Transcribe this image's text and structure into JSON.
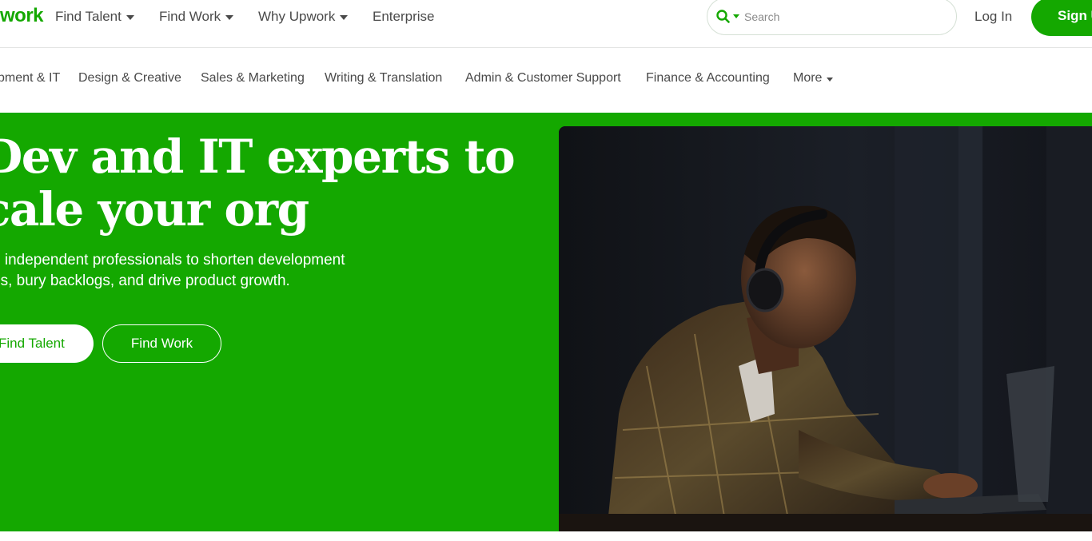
{
  "brand": {
    "logo_text": "work",
    "accent": "#14a800"
  },
  "topnav": {
    "items": [
      {
        "label": "Find Talent",
        "has_caret": true
      },
      {
        "label": "Find Work",
        "has_caret": true
      },
      {
        "label": "Why Upwork",
        "has_caret": true
      },
      {
        "label": "Enterprise",
        "has_caret": false
      }
    ],
    "search": {
      "placeholder": "Search",
      "icon": "search-icon"
    },
    "login_label": "Log In",
    "signup_label": "Sign Up"
  },
  "categories": {
    "items": [
      "pment & IT",
      "Design & Creative",
      "Sales & Marketing",
      "Writing & Translation",
      "Admin & Customer Support",
      "Finance & Accounting"
    ],
    "more_label": "More"
  },
  "hero": {
    "headline_line1": "Dev and IT experts to",
    "headline_line2": "cale your org",
    "subtext_line1": "e independent professionals to shorten development",
    "subtext_line2": "es, bury backlogs, and drive product growth.",
    "primary_button": "Find Talent",
    "secondary_button": "Find Work",
    "background": "#14a800"
  }
}
